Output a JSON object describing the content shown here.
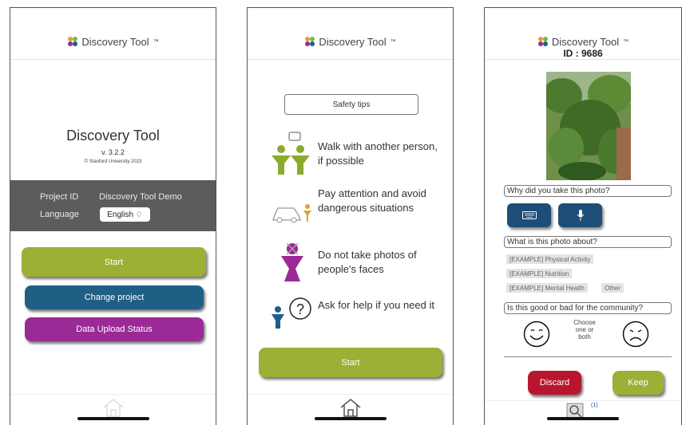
{
  "brand": {
    "name": "Discovery Tool",
    "tm": "™"
  },
  "screen1": {
    "title": "Discovery Tool",
    "version": "v. 3.2.2",
    "copyright": "© Stanford University 2023",
    "project_label": "Project ID",
    "project_value": "Discovery Tool Demo",
    "language_label": "Language",
    "language_value": "English ♢",
    "start_label": "Start",
    "change_project_label": "Change project",
    "upload_label": "Data Upload Status"
  },
  "screen2": {
    "safety_tips_label": "Safety tips",
    "tips": [
      "Walk with another person, if possible",
      "Pay attention and avoid dangerous situations",
      "Do not take photos of people's faces",
      "Ask for help if you need it"
    ],
    "start_label": "Start"
  },
  "screen3": {
    "id_text": "ID : 9686",
    "question1": "Why did you take this photo?",
    "question2": "What is this photo about?",
    "tags": [
      "[EXAMPLE] Physical Activity",
      "[EXAMPLE] Nutrition",
      "[EXAMPLE] Mental Health",
      "Other"
    ],
    "question3": "Is this good or bad for the community?",
    "choose_text": "Choose one or both",
    "discard_label": "Discard",
    "keep_label": "Keep",
    "badge_count": "(1)"
  },
  "colors": {
    "green": "#9bb035",
    "blue": "#1f5f86",
    "purple": "#9a2a96",
    "red": "#b8162f",
    "grey": "#5b5c5d"
  }
}
